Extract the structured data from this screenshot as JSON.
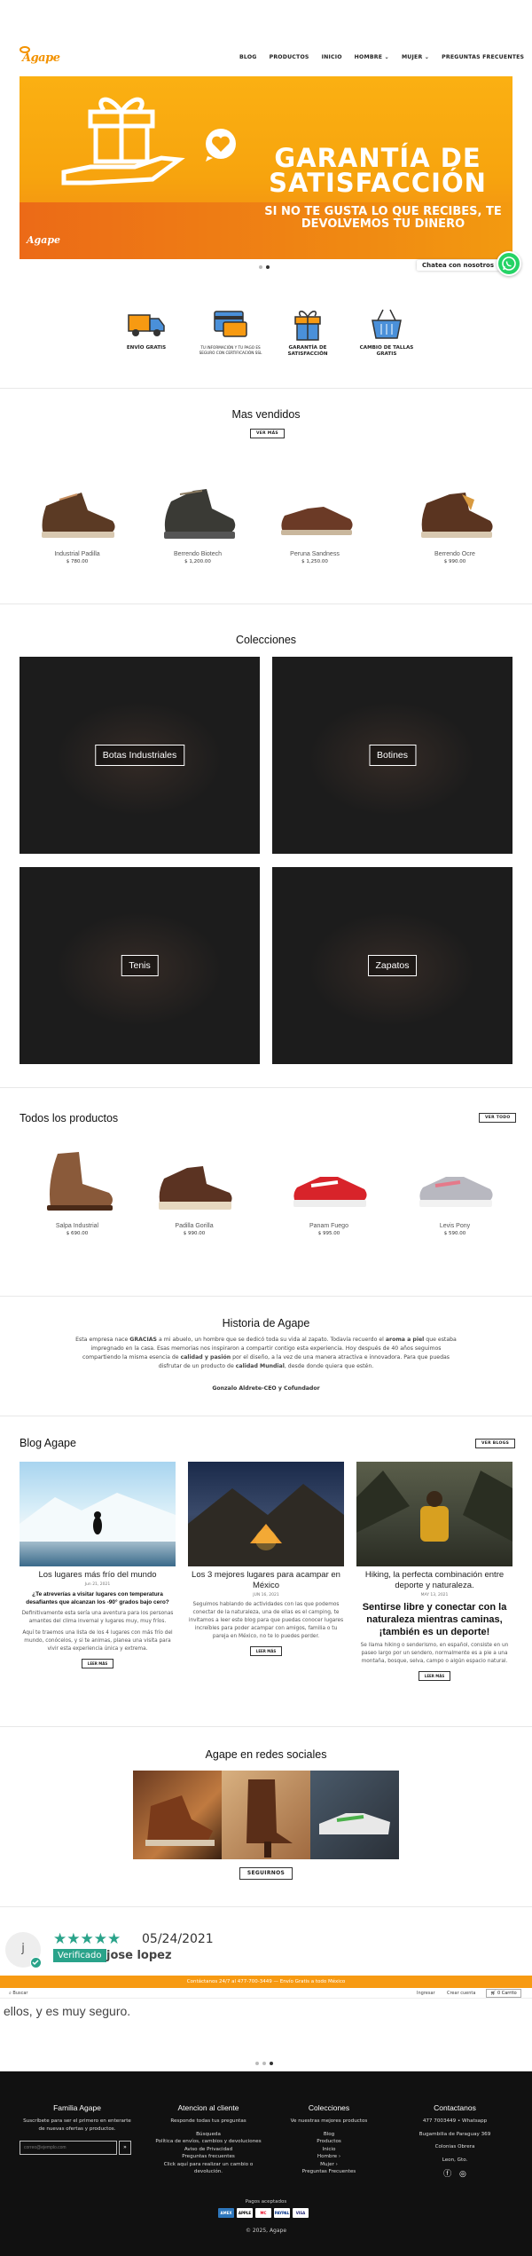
{
  "header": {
    "logo": "Agape",
    "nav": [
      {
        "label": "BLOG"
      },
      {
        "label": "PRODUCTOS"
      },
      {
        "label": "INICIO"
      },
      {
        "label": "HOMBRE",
        "caret": true
      },
      {
        "label": "MUJER",
        "caret": true
      },
      {
        "label": "PREGUNTAS FRECUENTES"
      }
    ]
  },
  "hero": {
    "title_line1": "GARANTÍA DE",
    "title_line2": "SATISFACCIÓN",
    "subtitle_line1": "SI NO TE GUSTA LO QUE RECIBES, TE",
    "subtitle_line2": "DEVOLVEMOS TU DINERO",
    "slide_count": 2,
    "active_slide": 2
  },
  "chat": {
    "label": "Chatea con nosotros",
    "icon": "whatsapp-icon"
  },
  "features": [
    {
      "label": "ENVÍO GRATIS",
      "icon": "truck-icon"
    },
    {
      "label": "TU INFORMACIÓN Y TU PAGO ES SEGURO CON CERTIFICACIÓN SSL",
      "icon": "card-icon"
    },
    {
      "label": "GARANTÍA DE SATISFACCIÓN",
      "icon": "gift-icon"
    },
    {
      "label": "CAMBIO DE TALLAS GRATIS",
      "icon": "basket-icon"
    }
  ],
  "best_sellers": {
    "title": "Mas vendidos",
    "button": "VER MÁS",
    "products": [
      {
        "name": "Industrial Padilla",
        "price": "$ 780.00"
      },
      {
        "name": "Berrendo Biotech",
        "price": "$ 1,200.00"
      },
      {
        "name": "Peruna Sandness",
        "price": "$ 1,250.00"
      },
      {
        "name": "Berrendo Ocre",
        "price": "$ 990.00"
      }
    ]
  },
  "collections": {
    "title": "Colecciones",
    "items": [
      {
        "label": "Botas Industriales"
      },
      {
        "label": "Botines"
      },
      {
        "label": "Tenis"
      },
      {
        "label": "Zapatos"
      }
    ]
  },
  "all_products": {
    "title": "Todos los productos",
    "button": "VER TODO",
    "products": [
      {
        "name": "Salpa Industrial",
        "price": "$ 690.00"
      },
      {
        "name": "Padilla Gorilla",
        "price": "$ 990.00"
      },
      {
        "name": "Panam Fuego",
        "price": "$ 995.00"
      },
      {
        "name": "Levis Pony",
        "price": "$ 590.00"
      }
    ]
  },
  "history": {
    "title": "Historia de Agape",
    "text_1": "Esta empresa nace ",
    "text_bold_1": "GRACIAS",
    "text_2": " a mi abuelo, un hombre que se dedicó toda su vida al zapato. Todavía recuerdo el ",
    "text_bold_2": "aroma a piel",
    "text_3": " que estaba impregnado en la casa. Esas memorias nos inspiraron a compartir contigo esta experiencia. Hoy después de 40 años seguimos compartiendo la misma esencia de ",
    "text_bold_3": "calidad y pasión",
    "text_4": " por el diseño, a la vez de una manera atractiva e innovadora. Para que puedas disfrutar de un producto de ",
    "text_bold_4": "calidad Mundial",
    "text_5": ", desde donde quiera que estén.",
    "signature": "Gonzalo Aldrete-CEO y Cofundador"
  },
  "blog": {
    "title": "Blog Agape",
    "button": "VER BLOGS",
    "posts": [
      {
        "title": "Los lugares más frío del mundo",
        "date": "Jun 21, 2021",
        "heading": "¿Te atreverías a visitar lugares con temperatura desafiantes que alcanzan los -90° grados bajo cero?",
        "body": "Definitivamente esta sería una aventura para los personas amantes del clima invernal y lugares muy, muy fríos.",
        "body2": "Aquí te traemos una lista de los 4 lugares con más frío del mundo, conócelos, y si te animas, planea una visita para vivir esta experiencia única y extrema.",
        "more": "LEER MÁS"
      },
      {
        "title": "Los 3 mejores lugares para acampar en México",
        "date": "JUN 16, 2021",
        "body": "Seguimos hablando de actividades con las que podemos conectar de la naturaleza, una de ellas es el camping, te invitamos a leer este blog para que puedas conocer lugares increíbles para poder acampar con amigos, familia o tu pareja en México, no te lo puedes perder.",
        "more": "LEER MÁS"
      },
      {
        "title": "Hiking, la perfecta combinación entre deporte y naturaleza.",
        "date": "MAY 13, 2021",
        "heading": "Sentirse libre y conectar con la naturaleza mientras caminas, ¡también es un deporte!",
        "body": "Se llama hiking o senderismo, en español, consiste en un paseo largo por un sendero, normalmente es a pie a una montaña, bosque, selva, campo o algún espacio natural.",
        "more": "LEER MÁS"
      }
    ]
  },
  "social": {
    "title": "Agape en redes sociales",
    "button": "SEGUIRNOS"
  },
  "review": {
    "avatar_initial": "j",
    "stars": "★★★★★",
    "date": "05/24/2021",
    "badge": "Verificado",
    "name": "jose lopez",
    "overflow_text": "ellos, y es muy seguro."
  },
  "promo_bar": {
    "text": "Contáctanos 24/7 al 477-700-3449 — Envío Gratis a todo México"
  },
  "toolbar": {
    "search": "Buscar",
    "login": "Ingresar",
    "register": "Crear cuenta",
    "cart": "0 Carrito"
  },
  "footer": {
    "col1": {
      "title": "Familia Agape",
      "text": "Suscríbete para ser el primero en enterarte de nuevas ofertas y productos.",
      "email_placeholder": "correo@ejemplo.com",
      "submit": "»"
    },
    "col2": {
      "title": "Atencion al cliente",
      "items": [
        "Responde todas tus preguntas",
        "Búsqueda",
        "Política de envíos, cambios y devoluciones",
        "Aviso de Privacidad",
        "Preguntas frecuentes",
        "Click aquí para realizar un cambio o devolución."
      ]
    },
    "col3": {
      "title": "Colecciones",
      "items": [
        "Ve nuestras mejores productos",
        "Blog",
        "Productos",
        "Inicio",
        "Hombre ›",
        "Mujer ›",
        "Preguntas Frecuentes"
      ]
    },
    "col4": {
      "title": "Contactanos",
      "items": [
        "477 7003449 • Whatsapp",
        "Bugambilia de Paraguay 369",
        "Colonias Obrera",
        "Leon, Gto."
      ]
    },
    "payments_label": "Pagos aceptados",
    "payments": [
      "AMEX",
      "APPLE",
      "MC",
      "PAYPAL",
      "VISA"
    ],
    "copyright": "© 2025, Agape"
  },
  "colors": {
    "accent": "#f39200",
    "review_green": "#2aa38a",
    "whatsapp": "#25d366",
    "footer_bg": "#111111"
  }
}
